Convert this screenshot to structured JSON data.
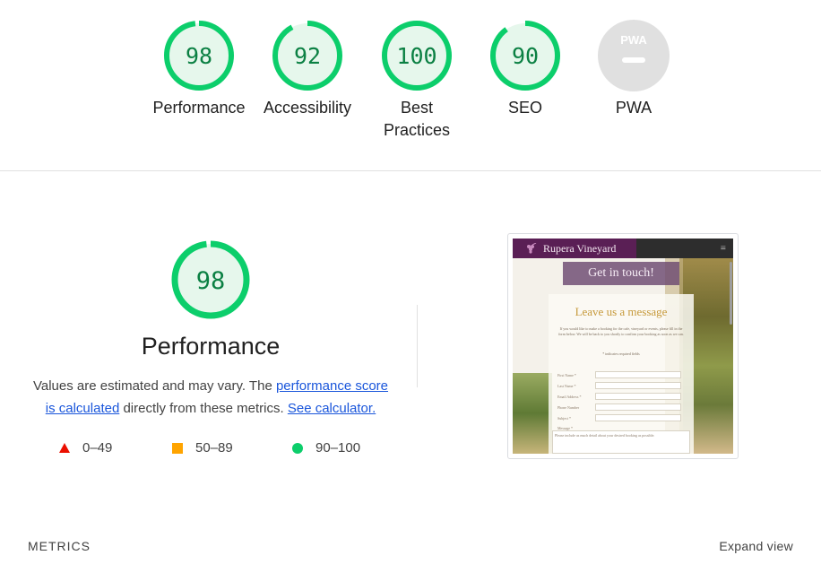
{
  "summary": {
    "categories": [
      {
        "label": "Performance",
        "score": "98",
        "score_value": 98,
        "color": "#0cce6b"
      },
      {
        "label": "Accessibility",
        "score": "92",
        "score_value": 92,
        "color": "#0cce6b"
      },
      {
        "label": "Best Practices",
        "score": "100",
        "score_value": 100,
        "color": "#0cce6b"
      },
      {
        "label": "SEO",
        "score": "90",
        "score_value": 90,
        "color": "#0cce6b"
      },
      {
        "label": "PWA",
        "badge": "PWA",
        "color": "#e0e0e0"
      }
    ]
  },
  "performance": {
    "score": "98",
    "score_value": 98,
    "title": "Performance",
    "desc_prefix": "Values are estimated and may vary. The ",
    "score_link": "performance score is calculated",
    "desc_middle": " directly from these metrics. ",
    "calc_link": "See calculator.",
    "legend": [
      {
        "range": "0–49",
        "shape": "triangle",
        "color": "#eb0f00"
      },
      {
        "range": "50–89",
        "shape": "square",
        "color": "#ffa400"
      },
      {
        "range": "90–100",
        "shape": "circle",
        "color": "#0cce6b"
      }
    ]
  },
  "thumbnail": {
    "brand": "Rupera Vineyard",
    "banner": "Get in touch!",
    "heading": "Leave us a message",
    "intro": "If you would like to make a booking for the cafe, vineyard or events, please fill in the form below. We will be back to you shortly to confirm your booking as soon as we can.",
    "required_note": "* indicates required fields",
    "fields": [
      "First Name *",
      "Last Name *",
      "Email Address *",
      "Phone Number",
      "Subject *",
      "Message *"
    ],
    "message_placeholder": "Please include as much detail about your desired booking as possible."
  },
  "footer": {
    "metrics_label": "METRICS",
    "expand_label": "Expand view"
  },
  "colors": {
    "pass_ring": "#0cce6b",
    "pass_fill": "#e6f7ec",
    "pass_text": "#0b8043",
    "link": "#1a56db"
  }
}
